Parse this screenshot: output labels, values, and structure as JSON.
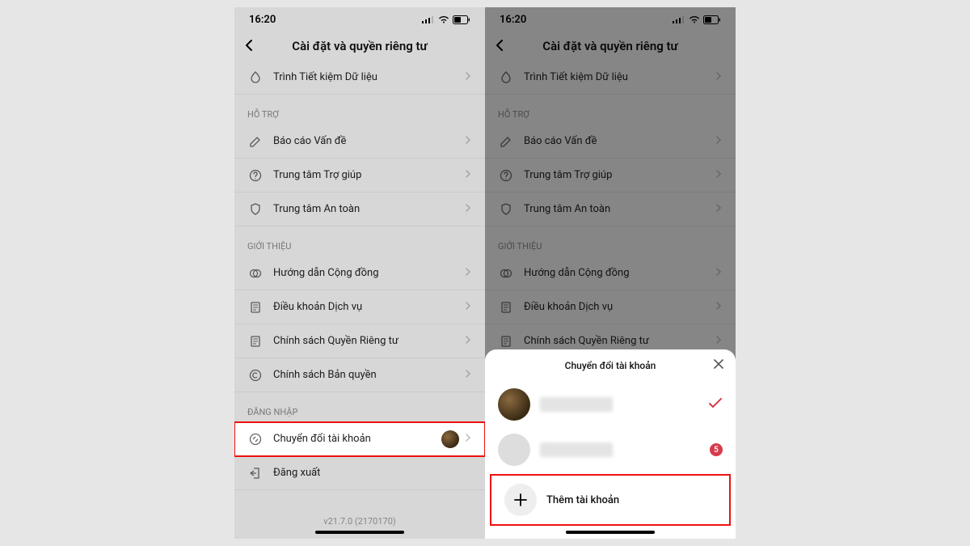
{
  "status": {
    "time": "16:20"
  },
  "header": {
    "title": "Cài đặt và quyền riêng tư"
  },
  "rows": {
    "data_saver": "Trình Tiết kiệm Dữ liệu",
    "support": "HỖ TRỢ",
    "report": "Báo cáo Vấn đề",
    "help": "Trung tâm Trợ giúp",
    "safety": "Trung tâm An toàn",
    "about": "GIỚI THIỆU",
    "guidelines": "Hướng dẫn Cộng đồng",
    "terms": "Điều khoản Dịch vụ",
    "privacy": "Chính sách Quyền Riêng tư",
    "copyright": "Chính sách Bản quyền",
    "login": "ĐĂNG NHẬP",
    "switch": "Chuyển đổi tài khoản",
    "logout": "Đăng xuất"
  },
  "version": "v21.7.0 (2170170)",
  "sheet": {
    "title": "Chuyển đổi tài khoản",
    "add": "Thêm tài khoản",
    "badge": "5"
  }
}
